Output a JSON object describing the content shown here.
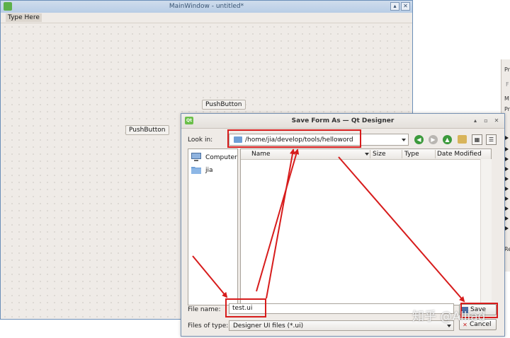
{
  "main_window": {
    "title": "MainWindow - untitled*",
    "menu_placeholder": "Type Here",
    "buttons": [
      {
        "label": "PushButton"
      },
      {
        "label": "PushButton"
      }
    ]
  },
  "right_panel": {
    "letters": [
      "Pr",
      "F",
      "M",
      "Pr",
      "Re"
    ]
  },
  "dialog": {
    "title": "Save Form As — Qt Designer",
    "look_in_label": "Look in:",
    "look_in_path": "/home/jia/develop/tools/helloword",
    "nav_icons": [
      "back-icon",
      "forward-icon",
      "up-icon",
      "new-folder-icon",
      "list-view-icon",
      "detail-view-icon"
    ],
    "sidebar": [
      {
        "label": "Computer",
        "icon": "computer-icon"
      },
      {
        "label": "jia",
        "icon": "folder-icon"
      }
    ],
    "columns": [
      "Name",
      "Size",
      "Type",
      "Date Modified"
    ],
    "file_name_label": "File name:",
    "file_name_value": "test.ui",
    "file_type_label": "Files of type:",
    "file_type_value": "Designer UI files (*.ui)",
    "save_label": "Save",
    "cancel_label": "Cancel"
  },
  "annotation_color": "#d71c1c",
  "watermark": "知乎 @Alliad"
}
